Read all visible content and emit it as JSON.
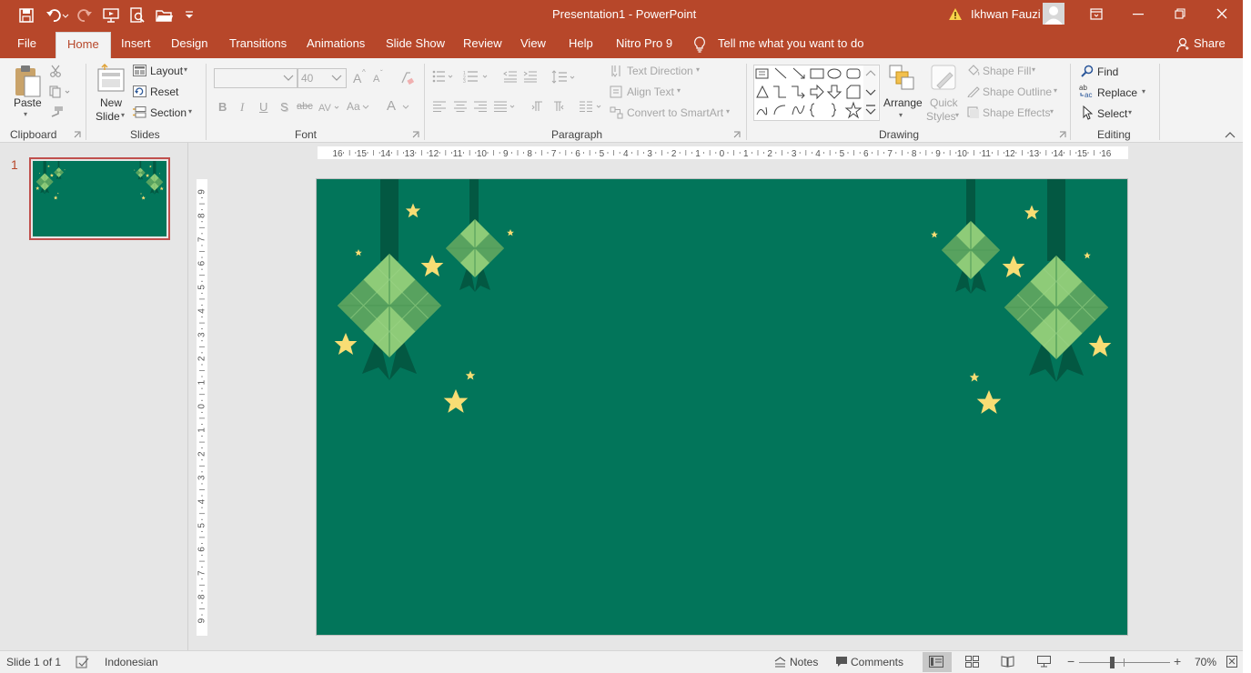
{
  "window": {
    "title": "Presentation1  -  PowerPoint",
    "user": "Ikhwan Fauzi"
  },
  "tabs": [
    "File",
    "Home",
    "Insert",
    "Design",
    "Transitions",
    "Animations",
    "Slide Show",
    "Review",
    "View",
    "Help",
    "Nitro Pro 9"
  ],
  "tell_me": "Tell me what you want to do",
  "share": "Share",
  "ribbon": {
    "clipboard": {
      "label": "Clipboard",
      "paste": "Paste"
    },
    "slides": {
      "label": "Slides",
      "new_slide_1": "New",
      "new_slide_2": "Slide",
      "layout": "Layout",
      "reset": "Reset",
      "section": "Section"
    },
    "font": {
      "label": "Font",
      "size": "40",
      "bold": "B",
      "italic": "I",
      "underline": "U",
      "shadow": "S",
      "strike": "abc",
      "case": "Aa",
      "grow": "A",
      "shrink": "A",
      "color": "A"
    },
    "paragraph": {
      "label": "Paragraph",
      "text_direction": "Text Direction",
      "align_text": "Align Text",
      "convert_smartart": "Convert to SmartArt"
    },
    "drawing": {
      "label": "Drawing",
      "arrange": "Arrange",
      "quick_styles_1": "Quick",
      "quick_styles_2": "Styles",
      "shape_fill": "Shape Fill",
      "shape_outline": "Shape Outline",
      "shape_effects": "Shape Effects"
    },
    "editing": {
      "label": "Editing",
      "find": "Find",
      "replace": "Replace",
      "select": "Select"
    }
  },
  "thumbnails": [
    {
      "number": "1"
    }
  ],
  "rulers": {
    "horizontal": [
      "16",
      "15",
      "14",
      "13",
      "12",
      "11",
      "10",
      "9",
      "8",
      "7",
      "6",
      "5",
      "4",
      "3",
      "2",
      "1",
      "0",
      "1",
      "2",
      "3",
      "4",
      "5",
      "6",
      "7",
      "8",
      "9",
      "10",
      "11",
      "12",
      "13",
      "14",
      "15",
      "16"
    ],
    "vertical": [
      "9",
      "8",
      "7",
      "6",
      "5",
      "4",
      "3",
      "2",
      "1",
      "0",
      "1",
      "2",
      "3",
      "4",
      "5",
      "6",
      "7",
      "8",
      "9"
    ]
  },
  "status": {
    "slide_info": "Slide 1 of 1",
    "language": "Indonesian",
    "notes": "Notes",
    "comments": "Comments",
    "zoom": "70%",
    "zoom_level": 0.36
  },
  "colors": {
    "accent": "#b7472a",
    "slide_bg": "#02755a",
    "ketupat_light": "#8ecb78",
    "ketupat_mid": "#6bb26a",
    "ribbon_dark": "#035842",
    "star": "#f8dd74"
  }
}
